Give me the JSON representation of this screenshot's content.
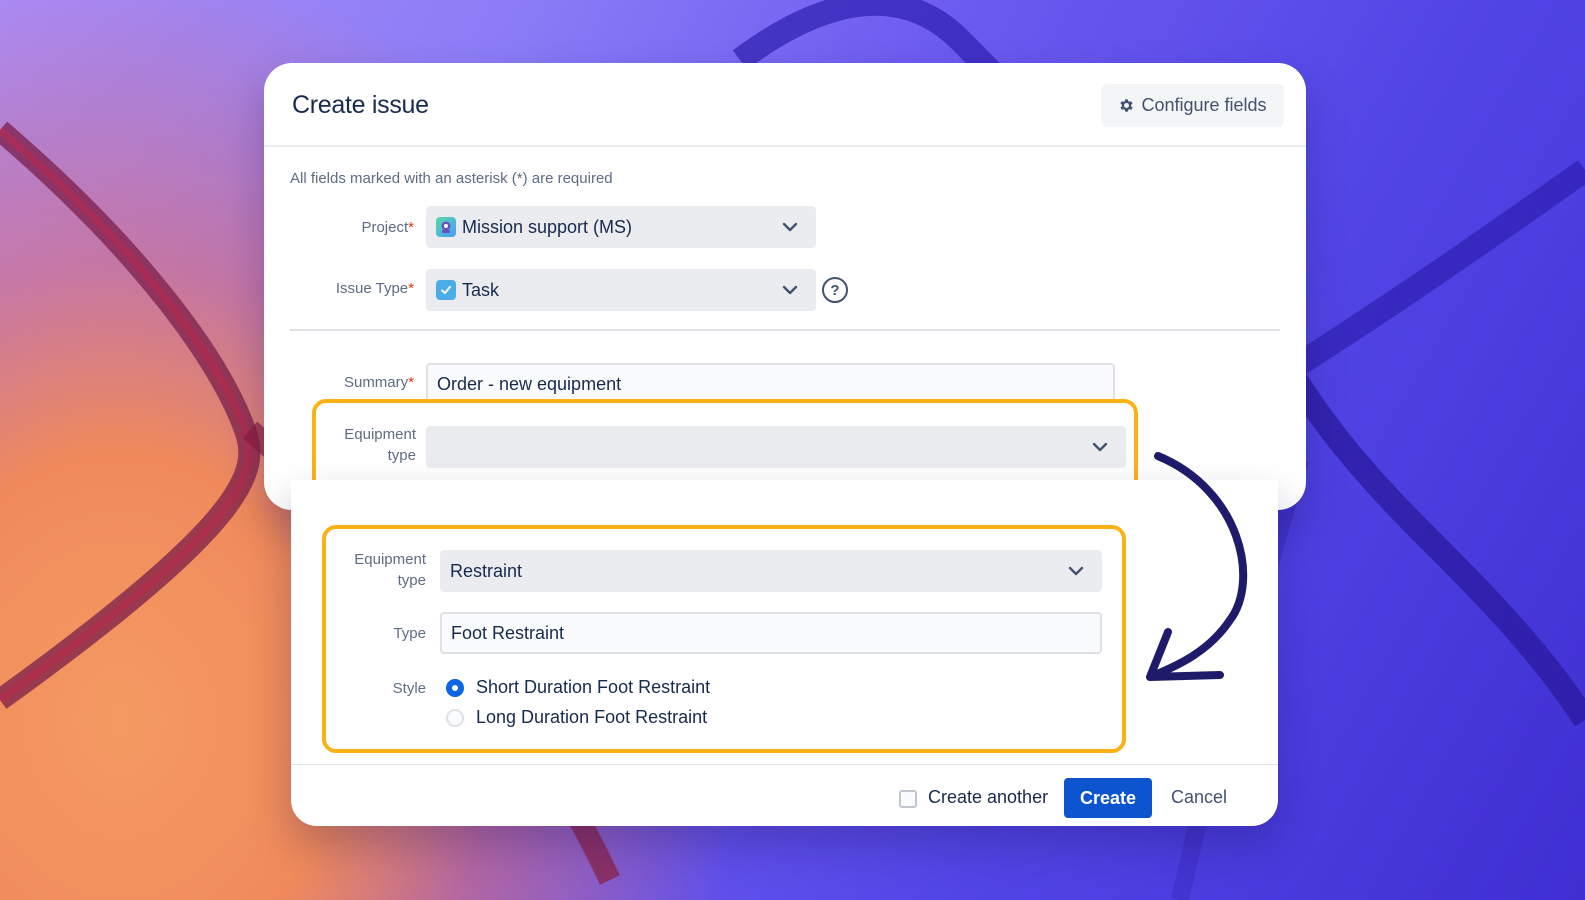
{
  "dialog": {
    "title": "Create issue",
    "configure_label": "Configure fields",
    "required_note": "All fields marked with an asterisk (*) are required"
  },
  "fields": {
    "project": {
      "label": "Project",
      "required": "*",
      "value": "Mission support (MS)",
      "icon": "project-avatar-icon"
    },
    "issue_type": {
      "label": "Issue Type",
      "required": "*",
      "value": "Task",
      "icon": "task-check-icon"
    },
    "summary": {
      "label": "Summary",
      "required": "*",
      "value": "Order - new equipment"
    },
    "equipment_type_empty": {
      "label_line1": "Equipment",
      "label_line2": "type",
      "value": ""
    }
  },
  "expanded": {
    "equipment_type": {
      "label_line1": "Equipment",
      "label_line2": "type",
      "value": "Restraint"
    },
    "type": {
      "label": "Type",
      "value": "Foot Restraint"
    },
    "style": {
      "label": "Style",
      "options": [
        {
          "label": "Short Duration Foot Restraint",
          "selected": true
        },
        {
          "label": "Long Duration Foot Restraint",
          "selected": false
        }
      ]
    }
  },
  "footer": {
    "create_another": "Create another",
    "create": "Create",
    "cancel": "Cancel"
  },
  "colors": {
    "highlight": "#fbb215",
    "primary": "#0c55cf",
    "arrow": "#1e1b6b"
  }
}
